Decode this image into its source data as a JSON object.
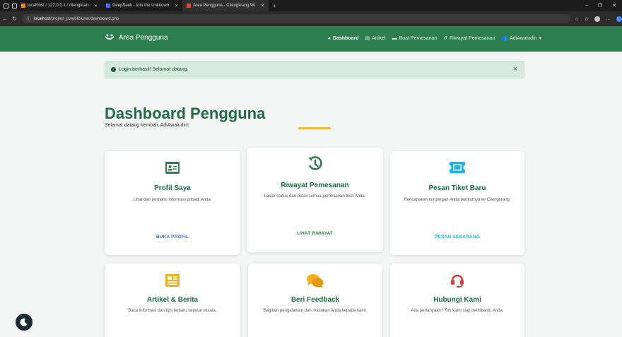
{
  "browser": {
    "tabs": [
      {
        "label": "localhost / 127.0.0.1 / cilengkran",
        "active": false,
        "favicon_color": "#f29111"
      },
      {
        "label": "DeepSeek - Into the Unknown",
        "active": false,
        "favicon_color": "#4d6bfe"
      },
      {
        "label": "Area Pengguna - Cilengkrang Wi",
        "active": true,
        "favicon_color": "#e8473b"
      }
    ],
    "url_host": "localhost",
    "url_path": "/project_pwebl2/user/dashboard.php"
  },
  "navbar": {
    "brand": "Area Pengguna",
    "links": [
      {
        "label": "Dashboard",
        "icon": "gauge-icon",
        "active": true
      },
      {
        "label": "Artikel",
        "icon": "newspaper-icon",
        "active": false
      },
      {
        "label": "Buat Pemesanan",
        "icon": "ticket-icon",
        "active": false
      },
      {
        "label": "Riwayat Pemesanan",
        "icon": "history-icon",
        "active": false
      },
      {
        "label": "AdiAwaludin",
        "icon": "users-icon",
        "active": false
      }
    ]
  },
  "alert": {
    "message": "Login berhasil! Selamat datang.",
    "close": "×"
  },
  "page": {
    "title": "Dashboard Pengguna",
    "subtitle": "Selamat datang kembali, AdiAwaludin!"
  },
  "cards": [
    {
      "title": "Profil Saya",
      "desc": "Lihat dan perbarui informasi pribadi Anda.",
      "link": "BUKA PROFIL",
      "icon": "id-card-icon",
      "icon_color": "#2e7d4f",
      "link_color": "#3b6fd8"
    },
    {
      "title": "Riwayat Pemesanan",
      "desc": "Lacak status dan detail semua pemesanan tiket Anda.",
      "link": "LIHAT RIWAYAT",
      "icon": "history-icon",
      "icon_color": "#2e7d4f",
      "link_color": "#2e7d4f"
    },
    {
      "title": "Pesan Tiket Baru",
      "desc": "Rencanakan kunjungan Anda berikutnya ke Cilengkrang.",
      "link": "PESAN SEKARANG",
      "icon": "ticket-icon",
      "icon_color": "#1bb3e0",
      "link_color": "#1bb3e0"
    },
    {
      "title": "Artikel & Berita",
      "desc": "Baca informasi dan tips terbaru seputar wisata.",
      "link": "",
      "icon": "newspaper-icon",
      "icon_color": "#f2b01e",
      "link_color": ""
    },
    {
      "title": "Beri Feedback",
      "desc": "Bagikan pengalaman dan masukan Anda kepada kami.",
      "link": "",
      "icon": "comments-icon",
      "icon_color": "#f2b01e",
      "link_color": ""
    },
    {
      "title": "Hubungi Kami",
      "desc": "Ada pertanyaan? Tim kami siap membantu Anda.",
      "link": "",
      "icon": "headset-icon",
      "icon_color": "#e23b3b",
      "link_color": ""
    }
  ]
}
